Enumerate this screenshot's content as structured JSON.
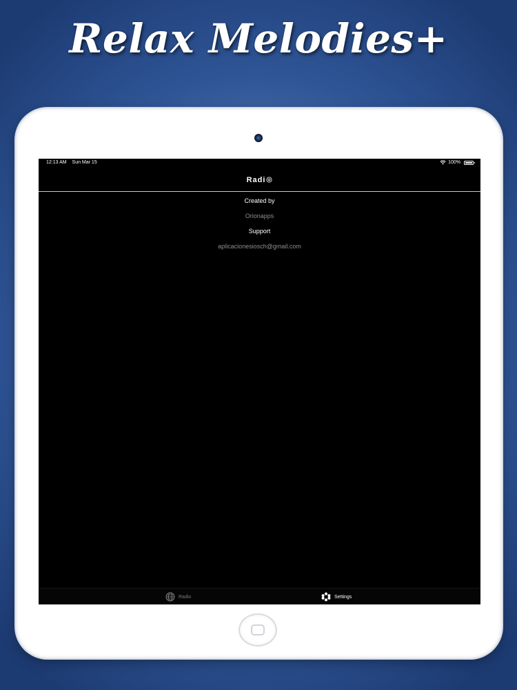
{
  "banner": {
    "title": "Relax Melodies+"
  },
  "status_bar": {
    "time": "12:13 AM",
    "date": "Sun Mar 15",
    "battery": "100%"
  },
  "nav": {
    "title": "Radi"
  },
  "content": {
    "created_by_label": "Created by",
    "created_by_value": "Orionapps",
    "support_label": "Support",
    "support_email": "aplicacionesiosch@gmail.com"
  },
  "tabs": [
    {
      "label": "Radio",
      "icon": "globe-icon",
      "selected": false
    },
    {
      "label": "Settings",
      "icon": "settings-icon",
      "selected": true
    }
  ],
  "colors": {
    "screen_background": "#000000",
    "text_primary": "#ffffff",
    "text_secondary": "#8e8e93",
    "tab_inactive": "#7a7a7e"
  }
}
